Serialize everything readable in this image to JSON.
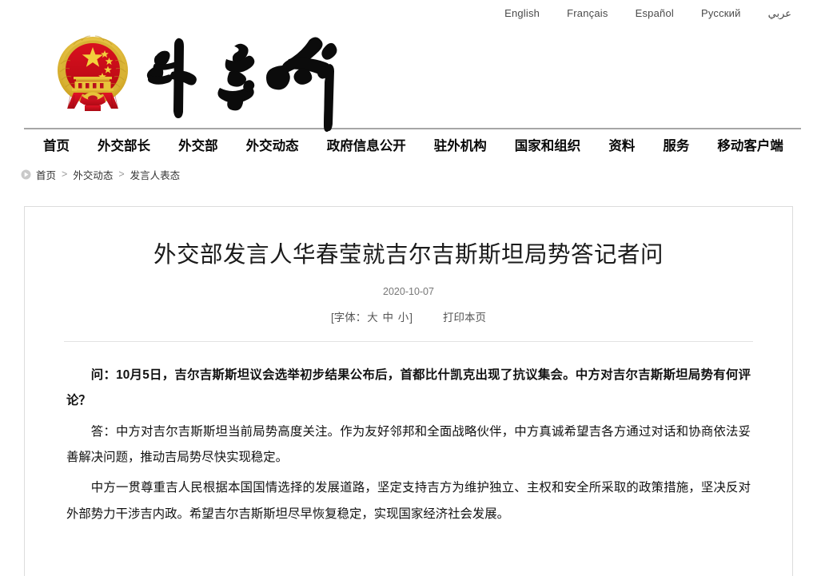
{
  "languages": [
    {
      "label": "English",
      "name": "lang-english"
    },
    {
      "label": "Français",
      "name": "lang-francais"
    },
    {
      "label": "Español",
      "name": "lang-espanol"
    },
    {
      "label": "Русский",
      "name": "lang-russian"
    },
    {
      "label": "عربي",
      "name": "lang-arabic"
    }
  ],
  "masthead": {
    "emblem_alt": "national-emblem-of-china",
    "wordmark_text": "外交部",
    "wordmark_alt": "ministry-of-foreign-affairs-calligraphy"
  },
  "nav": [
    {
      "label": "首页"
    },
    {
      "label": "外交部长"
    },
    {
      "label": "外交部"
    },
    {
      "label": "外交动态"
    },
    {
      "label": "政府信息公开"
    },
    {
      "label": "驻外机构"
    },
    {
      "label": "国家和组织"
    },
    {
      "label": "资料"
    },
    {
      "label": "服务"
    },
    {
      "label": "移动客户端"
    }
  ],
  "breadcrumb": {
    "icon": "arrow-circle-icon",
    "home": "首页",
    "sep1": ">",
    "section": "外交动态",
    "sep2": ">",
    "current": "发言人表态"
  },
  "article": {
    "title": "外交部发言人华春莹就吉尔吉斯斯坦局势答记者问",
    "date": "2020-10-07",
    "font_label_open": "[字体：",
    "font_large": "大",
    "font_medium": "中",
    "font_small": "小",
    "font_label_close": "]",
    "print_label": "打印本页",
    "paragraphs": [
      {
        "bold": true,
        "text": "问：10月5日，吉尔吉斯斯坦议会选举初步结果公布后，首都比什凯克出现了抗议集会。中方对吉尔吉斯斯坦局势有何评论？"
      },
      {
        "bold": false,
        "text": "答：中方对吉尔吉斯斯坦当前局势高度关注。作为友好邻邦和全面战略伙伴，中方真诚希望吉各方通过对话和协商依法妥善解决问题，推动吉局势尽快实现稳定。"
      },
      {
        "bold": false,
        "text": "中方一贯尊重吉人民根据本国国情选择的发展道路，坚定支持吉方为维护独立、主权和安全所采取的政策措施，坚决反对外部势力干涉吉内政。希望吉尔吉斯斯坦尽早恢复稳定，实现国家经济社会发展。"
      }
    ]
  },
  "colors": {
    "emblem_red": "#d4091c",
    "emblem_gold": "#e8c33a",
    "nav_rule": "#a6a6a6",
    "card_border": "#dcdcdc",
    "text": "#111111"
  }
}
